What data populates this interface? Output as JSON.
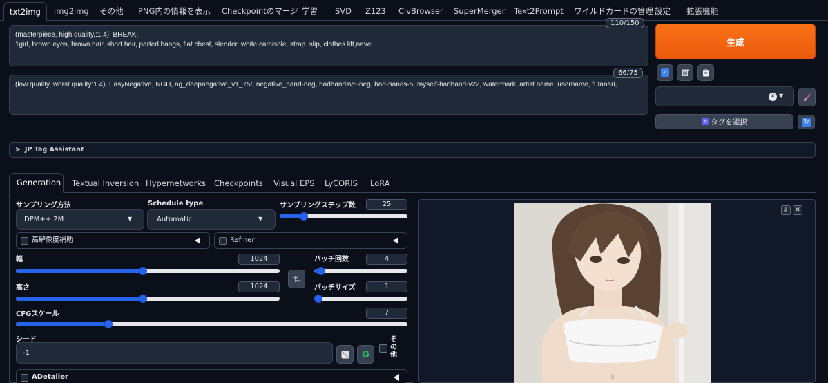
{
  "tabs": [
    "txt2img",
    "img2img",
    "その他",
    "PNG内の情報を表示",
    "Checkpointのマージ",
    "学習",
    "SVD",
    "Z123",
    "CivBrowser",
    "SuperMerger",
    "Text2Prompt",
    "ワイルドカードの管理",
    "設定",
    "拡張機能"
  ],
  "prompt": {
    "positive": "(masterpiece, high quality,:1.4), BREAK,\n1girl, brown eyes, brown hair, short hair, parted bangs, flat chest, slender, white camisole, strap  slip, clothes lift,navel",
    "positive_count": "110/150",
    "negative": "(low quality, worst quality:1.4), EasyNegative, NGH, ng_deepnegative_v1_75t, negative_hand-neg, badhandsv5-neg, bad-hands-5, myself-badhand-v22, watermark, artist name, username, futanari,",
    "negative_count": "66/75"
  },
  "actions": {
    "generate_label": "生成",
    "tag_select_label": "タグを選択"
  },
  "accordion_label": "JP Tag Assistant",
  "subtabs": [
    "Generation",
    "Textual Inversion",
    "Hypernetworks",
    "Checkpoints",
    "Visual EPS",
    "LyCORIS",
    "LoRA"
  ],
  "generation": {
    "sampler_label": "サンプリング方法",
    "sampler_value": "DPM++ 2M",
    "schedule_label": "Schedule type",
    "schedule_value": "Automatic",
    "steps_label": "サンプリングステップ数",
    "steps_value": "25",
    "steps_fraction": 0.17,
    "hires_label": "高解像度補助",
    "refiner_label": "Refiner",
    "width_label": "幅",
    "width_value": "1024",
    "width_fraction": 0.48,
    "height_label": "高さ",
    "height_value": "1024",
    "height_fraction": 0.48,
    "batch_count_label": "バッチ回数",
    "batch_count_value": "4",
    "batch_count_fraction": 0.03,
    "batch_size_label": "バッチサイズ",
    "batch_size_value": "1",
    "batch_size_fraction": 0.0,
    "cfg_label": "CFGスケール",
    "cfg_value": "7",
    "cfg_fraction": 0.23,
    "seed_label": "シード",
    "seed_value": "-1",
    "other_label": "その他",
    "adetailer_label": "ADetailer"
  },
  "colors": {
    "accent": "#2563eb",
    "generate": "#f97316",
    "background": "#0b0f19"
  }
}
